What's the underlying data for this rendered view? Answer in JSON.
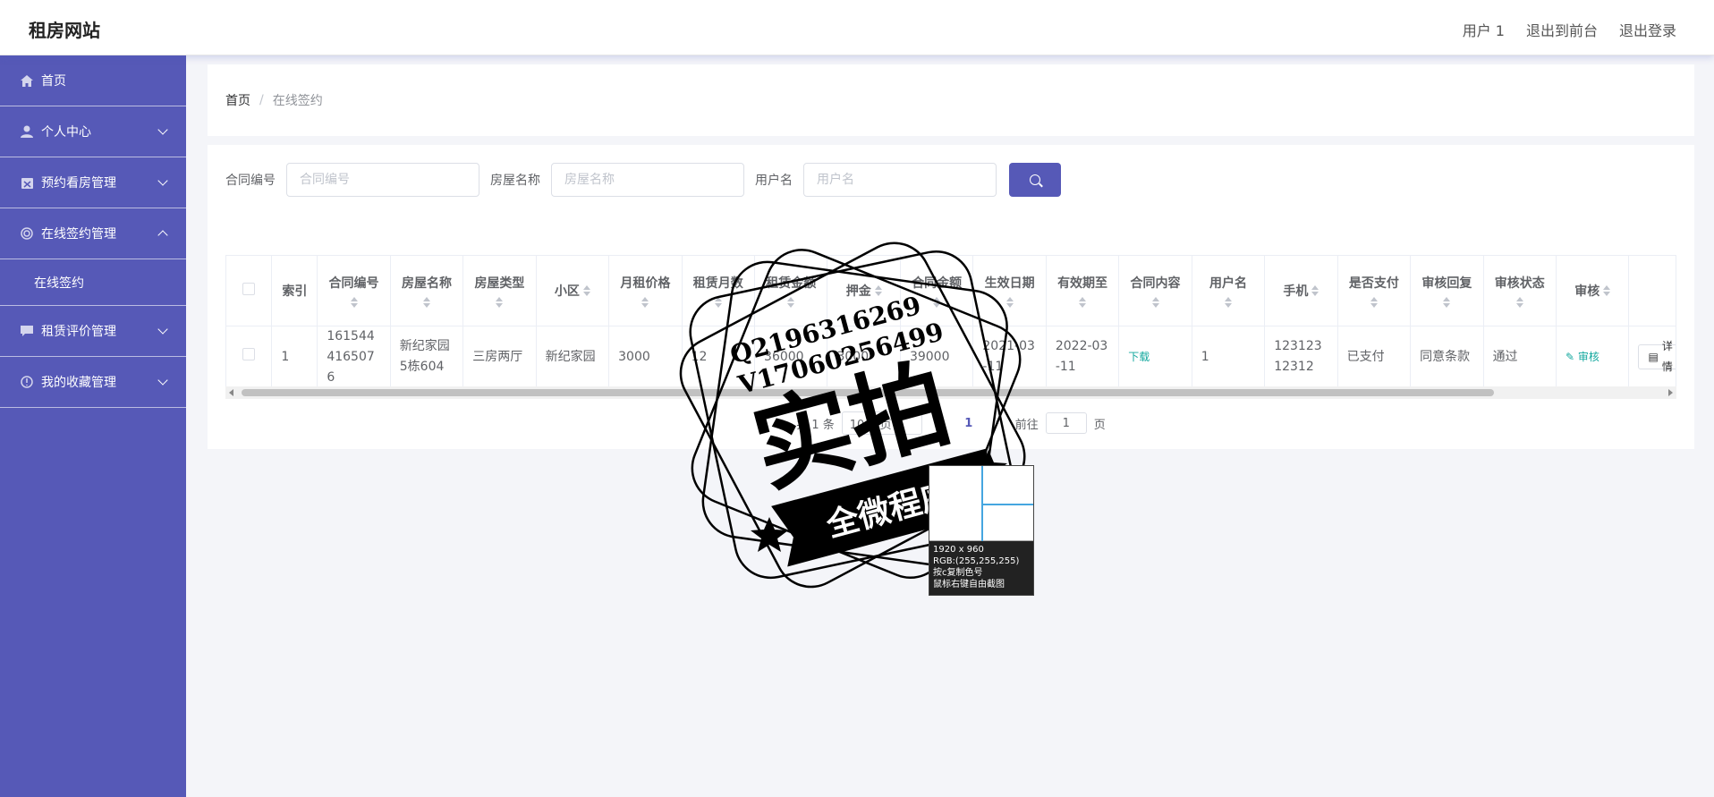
{
  "header": {
    "brand": "租房网站",
    "user": "用户 1",
    "to_front": "退出到前台",
    "logout": "退出登录"
  },
  "sidebar": {
    "items": [
      {
        "label": "首页",
        "icon": "home-icon"
      },
      {
        "label": "个人中心",
        "icon": "user-icon"
      },
      {
        "label": "预约看房管理",
        "icon": "calendar-icon"
      },
      {
        "label": "在线签约管理",
        "icon": "contract-icon"
      },
      {
        "label": "租赁评价管理",
        "icon": "comment-icon"
      },
      {
        "label": "我的收藏管理",
        "icon": "favorite-icon"
      }
    ],
    "sub_item": "在线签约"
  },
  "breadcrumb": {
    "home": "首页",
    "separator": "/",
    "current": "在线签约"
  },
  "search": {
    "contract_label": "合同编号",
    "contract_placeholder": "合同编号",
    "house_label": "房屋名称",
    "house_placeholder": "房屋名称",
    "user_label": "用户名",
    "user_placeholder": "用户名"
  },
  "table": {
    "headers": [
      "索引",
      "合同编号",
      "房屋名称",
      "房屋类型",
      "小区",
      "月租价格",
      "租赁月数",
      "租赁金额",
      "押金",
      "合同金额",
      "生效日期",
      "有效期至",
      "合同内容",
      "用户名",
      "手机",
      "是否支付",
      "审核回复",
      "审核状态",
      "审核"
    ],
    "rows": [
      {
        "index": "1",
        "contract_no": "1615444165076",
        "house_name": "新纪家园5栋604",
        "house_type": "三房两厅",
        "community": "新纪家园",
        "monthly_rent": "3000",
        "months": "12",
        "rent_amount": "36000",
        "deposit": "3000",
        "contract_amount": "39000",
        "start_date": "2021-03-11",
        "end_date": "2022-03-11",
        "content_link": "下载",
        "username": "1",
        "phone": "12312312312",
        "paid": "已支付",
        "reply": "同意条款",
        "status": "通过",
        "audit_btn": "审核",
        "detail_btn": "详情"
      }
    ]
  },
  "pagination": {
    "total_label": "共 1 条",
    "page_size": "10条/页",
    "current_page": "1",
    "goto_label": "前往",
    "goto_value": "1",
    "page_suffix": "页"
  },
  "watermark": {
    "line1": "Q2196316269",
    "line2": "V17060256499",
    "big": "实拍",
    "banner": "全微程序"
  },
  "color_picker": {
    "size": "1920 x 960",
    "rgb": "RGB:(255,255,255)",
    "hint1": "按c复制色号",
    "hint2": "鼠标右键自由截图"
  },
  "colors": {
    "accent": "#5659b7",
    "link": "#13a89e"
  }
}
